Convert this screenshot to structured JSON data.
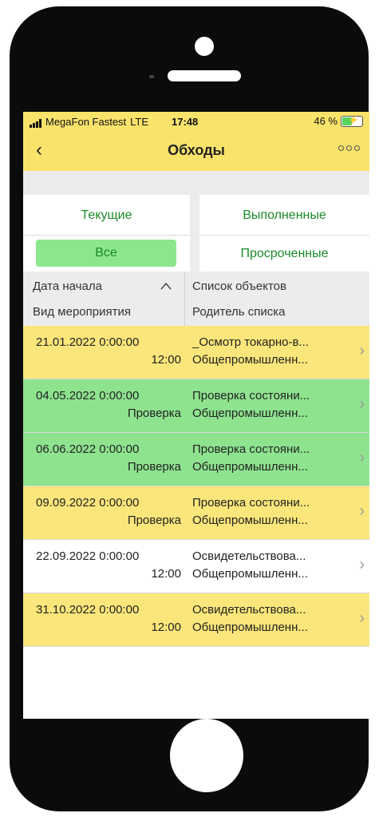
{
  "status": {
    "carrier": "MegaFon Fastest",
    "network": "LTE",
    "time": "17:48",
    "battery": "46 %"
  },
  "nav": {
    "back_icon": "‹",
    "title": "Обходы",
    "more_icon": "more-icon"
  },
  "filters": {
    "current": "Текущие",
    "done": "Выполненные",
    "all": "Все",
    "overdue": "Просроченные",
    "selected": "Все"
  },
  "table": {
    "col1_h1": "Дата начала",
    "col1_h2": "Вид мероприятия",
    "col2_h1": "Список объектов",
    "col2_h2": "Родитель списка",
    "sort_icon": "^",
    "rows": [
      {
        "date": "21.01.2022 0:00:00",
        "kind": "12:00",
        "object": "_Осмотр токарно-в...",
        "parent": "Общепромышленн...",
        "color": "#fae67a"
      },
      {
        "date": "04.05.2022 0:00:00",
        "kind": "Проверка",
        "object": "Проверка состояни...",
        "parent": "Общепромышленн...",
        "color": "#8ee38f"
      },
      {
        "date": "06.06.2022 0:00:00",
        "kind": "Проверка",
        "object": "Проверка состояни...",
        "parent": "Общепромышленн...",
        "color": "#8ee38f"
      },
      {
        "date": "09.09.2022 0:00:00",
        "kind": "Проверка",
        "object": "Проверка состояни...",
        "parent": "Общепромышленн...",
        "color": "#fae67a"
      },
      {
        "date": "22.09.2022 0:00:00",
        "kind": "12:00",
        "object": "Освидетельствова...",
        "parent": "Общепромышленн...",
        "color": "#ffffff"
      },
      {
        "date": "31.10.2022 0:00:00",
        "kind": "12:00",
        "object": "Освидетельствова...",
        "parent": "Общепромышленн...",
        "color": "#fae67a"
      }
    ]
  },
  "colors": {
    "accent_yellow": "#fae36b",
    "accent_green": "#8be68e",
    "text_green": "#1a8a2a"
  }
}
